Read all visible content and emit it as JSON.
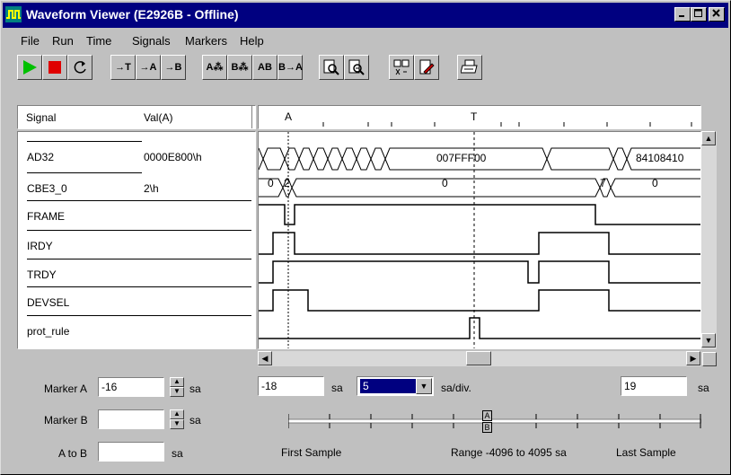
{
  "window": {
    "title": "Waveform Viewer (E2926B - Offline)"
  },
  "menu": [
    "File",
    "Run",
    "Time",
    "Signals",
    "Markers",
    "Help"
  ],
  "toolbar": {
    "buttons": [
      {
        "name": "run-icon"
      },
      {
        "name": "stop-icon"
      },
      {
        "name": "refresh-icon"
      },
      {
        "name": "goto-trigger-icon",
        "label": "→T"
      },
      {
        "name": "goto-marker-a-icon",
        "label": "→A"
      },
      {
        "name": "goto-marker-b-icon",
        "label": "→B"
      },
      {
        "name": "marker-a-to-view-icon",
        "label": "A⁂"
      },
      {
        "name": "marker-b-to-view-icon",
        "label": "B⁂"
      },
      {
        "name": "markers-ab-icon",
        "label": "AB"
      },
      {
        "name": "marker-b-a-icon",
        "label": "B→A"
      },
      {
        "name": "zoom-in-icon"
      },
      {
        "name": "zoom-out-icon"
      },
      {
        "name": "signal-select-icon"
      },
      {
        "name": "edit-doc-icon"
      },
      {
        "name": "print-icon"
      }
    ]
  },
  "signal_table": {
    "col_signal": "Signal",
    "col_value": "Val(A)",
    "rows": [
      {
        "name": "AD32",
        "value": "0000E800\\h"
      },
      {
        "name": "CBE3_0",
        "value": "2\\h"
      },
      {
        "name": "FRAME",
        "value": ""
      },
      {
        "name": "IRDY",
        "value": ""
      },
      {
        "name": "TRDY",
        "value": ""
      },
      {
        "name": "DEVSEL",
        "value": ""
      },
      {
        "name": "prot_rule",
        "value": ""
      }
    ]
  },
  "timeline": {
    "marker_a_label": "A",
    "trigger_label": "T"
  },
  "waves": {
    "ad32_value_1": "007FFF00",
    "ad32_value_2": "84108410",
    "cbe_value_0": "0",
    "cbe_value_2": "2",
    "cbe_value_main": "0",
    "cbe_value_7": "7",
    "cbe_value_end": "0"
  },
  "markers": {
    "marker_a_label": "Marker A",
    "marker_a_value": "-16",
    "marker_a_unit": "sa",
    "marker_b_label": "Marker B",
    "marker_b_value": "",
    "marker_b_unit": "sa",
    "a_to_b_label": "A to B",
    "a_to_b_value": "",
    "a_to_b_unit": "sa"
  },
  "view": {
    "start_value": "-18",
    "start_unit": "sa",
    "zoom_value": "5",
    "zoom_unit": "sa/div.",
    "end_value": "19",
    "end_unit": "sa"
  },
  "overview": {
    "first_sample": "First Sample",
    "range_text": "Range -4096 to 4095 sa",
    "last_sample": "Last Sample",
    "marker_a_tag": "A",
    "marker_b_tag": "B"
  }
}
